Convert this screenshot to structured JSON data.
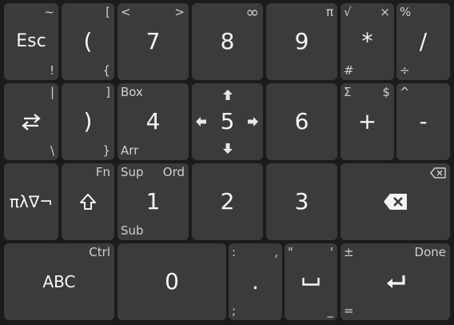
{
  "keys": {
    "esc": {
      "main": "Esc",
      "tr": "~",
      "br": "!"
    },
    "lparen": {
      "main": "(",
      "tr": "[",
      "br": "{"
    },
    "seven": {
      "main": "7",
      "tl": "<",
      "tr": ">"
    },
    "eight": {
      "main": "8",
      "tr": "∞"
    },
    "nine": {
      "main": "9",
      "tr": "π"
    },
    "mul": {
      "main": "*",
      "tl": "√",
      "tr": "×",
      "bl": "#"
    },
    "div": {
      "main": "/",
      "tl": "%",
      "bl": "÷"
    },
    "switch": {
      "tr": "|",
      "br": "\\"
    },
    "rparen": {
      "main": ")",
      "tr": "]",
      "br": "}"
    },
    "four": {
      "main": "4",
      "tl": "Box",
      "bl": "Arr"
    },
    "five": {
      "main": "5"
    },
    "six": {
      "main": "6"
    },
    "plus": {
      "main": "+",
      "tl": "Σ",
      "tr": "$"
    },
    "minus": {
      "main": "-",
      "tl": "^"
    },
    "greek": {
      "main": "πλ∇¬"
    },
    "shift": {
      "tr": "Fn"
    },
    "one": {
      "main": "1",
      "tl": "Sup",
      "tr": "Ord",
      "bl": "Sub"
    },
    "two": {
      "main": "2"
    },
    "three": {
      "main": "3"
    },
    "abc": {
      "main": "ABC",
      "tr": "Ctrl"
    },
    "zero": {
      "main": "0"
    },
    "dot": {
      "main": ".",
      "tl": ":",
      "tr": ",",
      "bl": ";"
    },
    "space": {
      "tl": "\"",
      "tr": "'",
      "br": "_"
    },
    "enter": {
      "tl": "±",
      "tr": "Done",
      "bl": "="
    }
  },
  "icons": {
    "switch": "swap-arrows-icon",
    "shift": "shift-arrow-icon",
    "backspace": "backspace-icon",
    "space": "space-bar-icon",
    "enter": "enter-arrow-icon"
  },
  "colors": {
    "background": "#1b1b1b",
    "key": "#3b3b3b",
    "text": "#f5f5f5",
    "sublabel": "#d0d0d0"
  }
}
